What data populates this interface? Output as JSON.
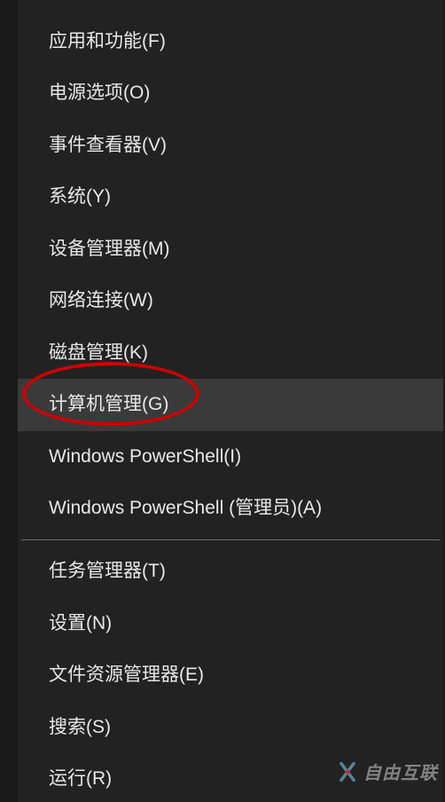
{
  "menu": {
    "groups": [
      {
        "items": [
          {
            "label": "应用和功能(F)",
            "name": "menu-item-apps-features",
            "highlighted": false
          },
          {
            "label": "电源选项(O)",
            "name": "menu-item-power-options",
            "highlighted": false
          },
          {
            "label": "事件查看器(V)",
            "name": "menu-item-event-viewer",
            "highlighted": false
          },
          {
            "label": "系统(Y)",
            "name": "menu-item-system",
            "highlighted": false
          },
          {
            "label": "设备管理器(M)",
            "name": "menu-item-device-manager",
            "highlighted": false
          },
          {
            "label": "网络连接(W)",
            "name": "menu-item-network-connections",
            "highlighted": false
          },
          {
            "label": "磁盘管理(K)",
            "name": "menu-item-disk-management",
            "highlighted": false
          },
          {
            "label": "计算机管理(G)",
            "name": "menu-item-computer-management",
            "highlighted": true
          },
          {
            "label": "Windows PowerShell(I)",
            "name": "menu-item-powershell",
            "highlighted": false
          },
          {
            "label": "Windows PowerShell (管理员)(A)",
            "name": "menu-item-powershell-admin",
            "highlighted": false
          }
        ]
      },
      {
        "items": [
          {
            "label": "任务管理器(T)",
            "name": "menu-item-task-manager",
            "highlighted": false
          },
          {
            "label": "设置(N)",
            "name": "menu-item-settings",
            "highlighted": false
          },
          {
            "label": "文件资源管理器(E)",
            "name": "menu-item-file-explorer",
            "highlighted": false
          },
          {
            "label": "搜索(S)",
            "name": "menu-item-search",
            "highlighted": false
          },
          {
            "label": "运行(R)",
            "name": "menu-item-run",
            "highlighted": false
          }
        ]
      }
    ]
  },
  "annotation": {
    "circled_item": "计算机管理(G)"
  },
  "watermark": {
    "text": "自由互联"
  }
}
